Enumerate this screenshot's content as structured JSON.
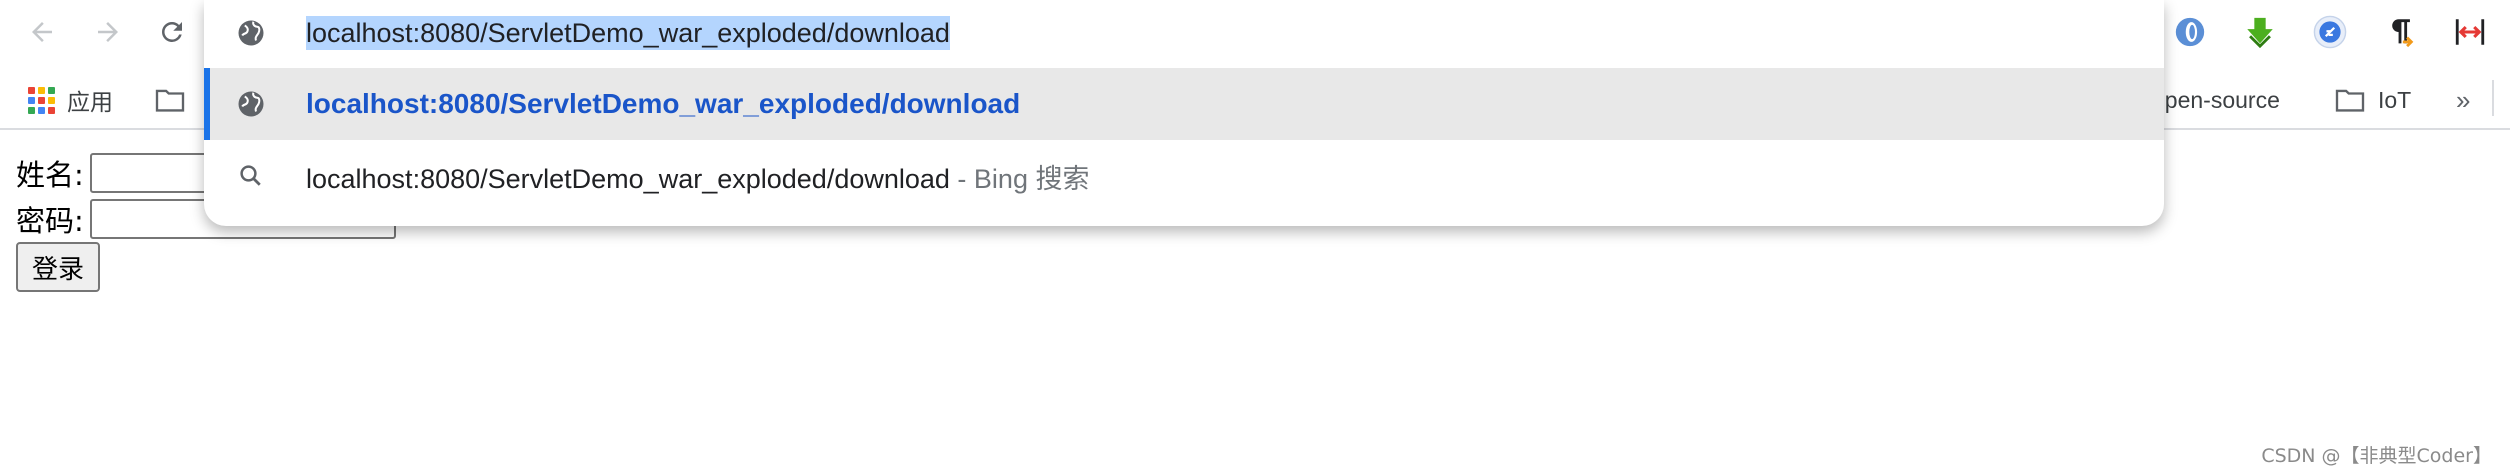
{
  "toolbar": {
    "back_icon": "arrow-left-icon",
    "forward_icon": "arrow-right-icon",
    "reload_icon": "reload-icon",
    "extensions": [
      "opera-icon",
      "download-arrow-icon",
      "feather-icon",
      "paragraph-icon",
      "resize-arrows-icon"
    ]
  },
  "omnibox": {
    "input_value": "localhost:8080/ServletDemo_war_exploded/download",
    "suggestions": [
      {
        "icon": "globe-icon",
        "text": "localhost:8080/ServletDemo_war_exploded/download",
        "suffix": ""
      },
      {
        "icon": "search-icon",
        "text": "localhost:8080/ServletDemo_war_exploded/download",
        "suffix": " - Bing 搜索"
      }
    ]
  },
  "bookmarks": {
    "apps_label": "应用",
    "opensource_label": "open-source",
    "iot_label": "IoT",
    "more_label": "»"
  },
  "form": {
    "name_label": "姓名:",
    "password_label": "密码:",
    "login_label": "登录"
  },
  "watermark": "CSDN @【非典型Coder】",
  "colors": {
    "accent": "#1a73e8",
    "link_blue": "#1a55c9",
    "selection": "#b4d5fe",
    "highlight_row": "#e8e8e8"
  }
}
